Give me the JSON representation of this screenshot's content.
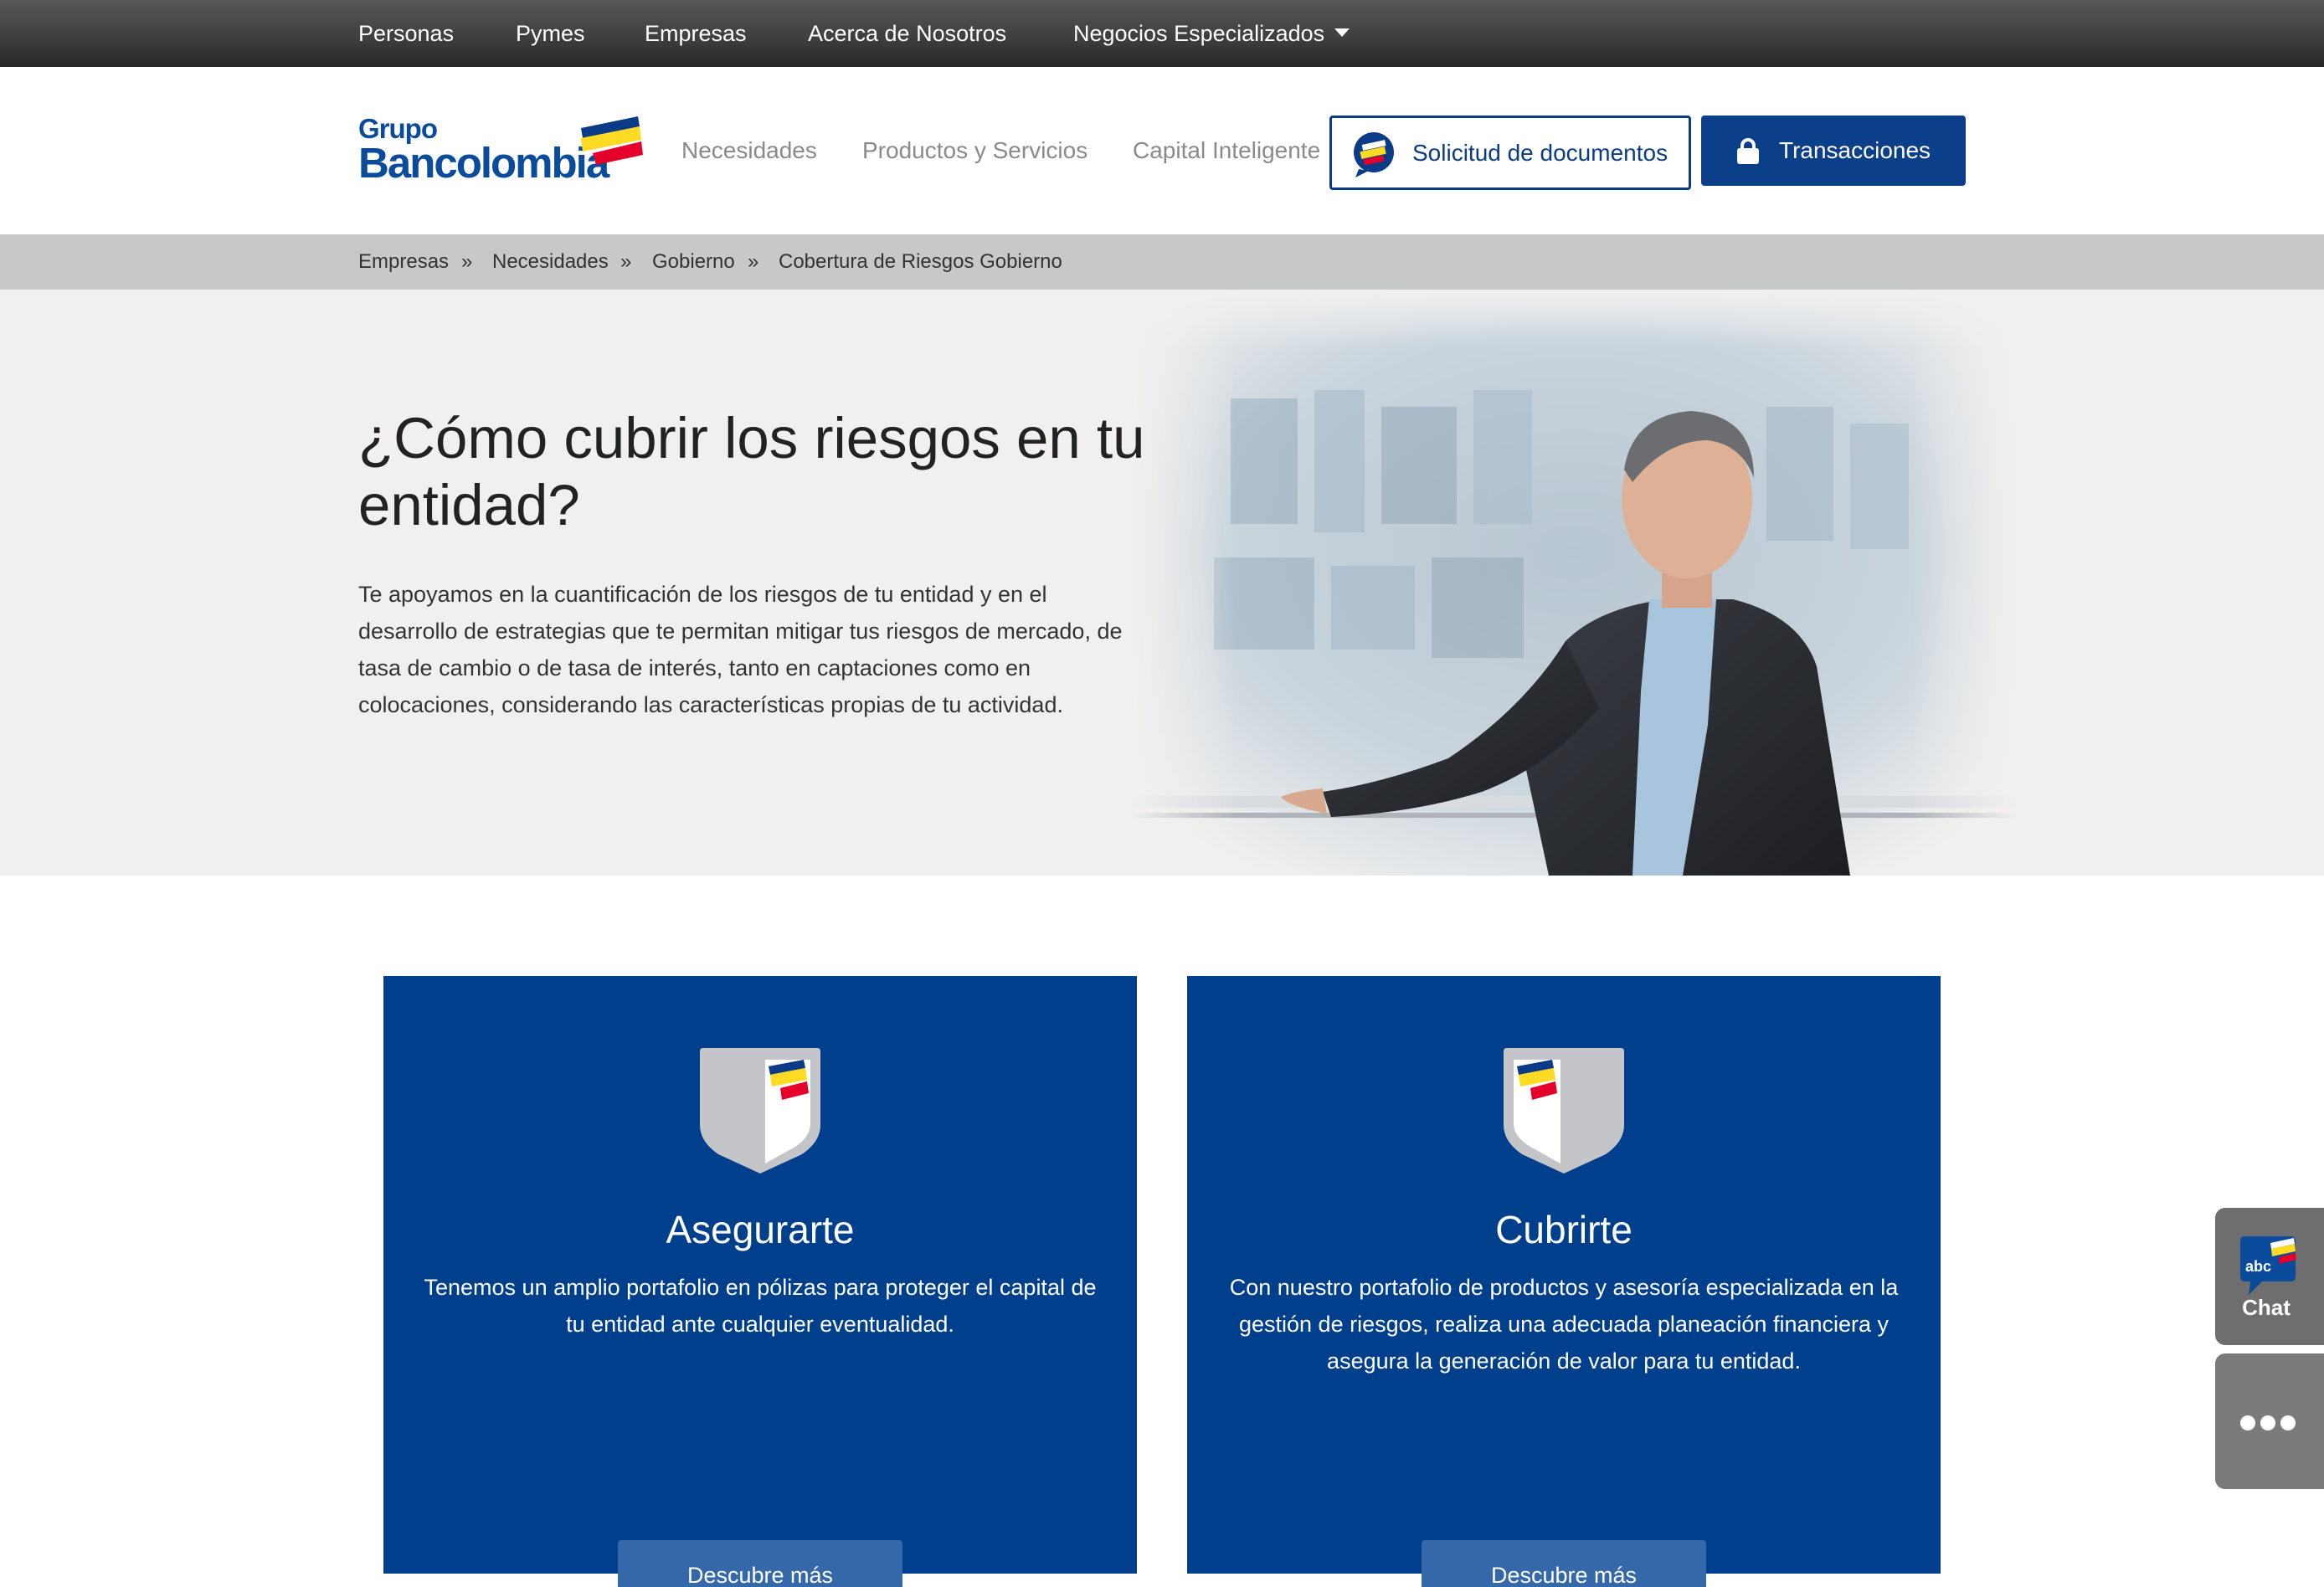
{
  "topnav": {
    "items": [
      {
        "label": "Personas"
      },
      {
        "label": "Pymes"
      },
      {
        "label": "Empresas"
      },
      {
        "label": "Acerca de Nosotros"
      },
      {
        "label": "Negocios Especializados"
      }
    ]
  },
  "header": {
    "logo": {
      "line1": "Grupo",
      "line2": "Bancolombia"
    },
    "nav": [
      {
        "label": "Necesidades"
      },
      {
        "label": "Productos y Servicios"
      },
      {
        "label": "Capital Inteligente"
      }
    ],
    "docs_button": "Solicitud de documentos",
    "transactions_button": "Transacciones"
  },
  "breadcrumb": {
    "items": [
      "Empresas",
      "Necesidades",
      "Gobierno",
      "Cobertura de Riesgos Gobierno"
    ],
    "separator": "»"
  },
  "hero": {
    "title": "¿Cómo cubrir los riesgos en tu entidad?",
    "text": "Te apoyamos en la cuantificación de los  riesgos de tu entidad y en el desarrollo de estrategias que te permitan mitigar tus riesgos de mercado, de tasa de cambio o de tasa de interés, tanto en captaciones como en colocaciones, considerando las características propias de tu actividad."
  },
  "cards": [
    {
      "title": "Asegurarte",
      "text": "Tenemos un amplio portafolio en pólizas para proteger el capital de tu entidad ante cualquier eventualidad.",
      "button": "Descubre más"
    },
    {
      "title": "Cubrirte",
      "text": "Con nuestro portafolio de productos y asesoría especializada en la gestión de riesgos, realiza una adecuada planeación financiera y asegura la generación de valor para tu entidad.",
      "button": "Descubre más"
    }
  ],
  "floating": {
    "chat_badge": "abc",
    "chat_label": "Chat"
  },
  "colors": {
    "brand_blue": "#003f8c",
    "brand_yellow": "#fdda24",
    "brand_red": "#e4002b",
    "topnav_bg": "#3d3d3d",
    "breadcrumb_bg": "#c7c8ca",
    "hero_bg": "#f1f0ef"
  },
  "icons": [
    "caret-down-icon",
    "bancolombia-flag-icon",
    "docs-chat-icon",
    "lock-icon",
    "shield-icon",
    "chat-bubble-icon",
    "more-dots-icon"
  ]
}
